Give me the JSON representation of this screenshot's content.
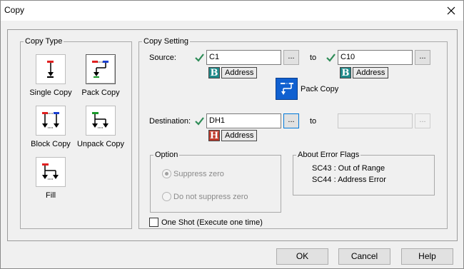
{
  "window": {
    "title": "Copy"
  },
  "copy_type": {
    "legend": "Copy Type",
    "items": [
      {
        "label": "Single Copy",
        "icon": "single-copy-icon"
      },
      {
        "label": "Pack Copy",
        "icon": "pack-copy-icon",
        "selected": true
      },
      {
        "label": "Block Copy",
        "icon": "block-copy-icon"
      },
      {
        "label": "Unpack Copy",
        "icon": "unpack-copy-icon"
      },
      {
        "label": "Fill",
        "icon": "fill-icon"
      }
    ]
  },
  "copy_setting": {
    "legend": "Copy Setting",
    "source": {
      "label": "Source:",
      "from_value": "C1",
      "to_label": "to",
      "to_value": "C10",
      "from_addr_badge": "B",
      "from_addr_label": "Address",
      "to_addr_badge": "B",
      "to_addr_label": "Address"
    },
    "pack_copy_label": "Pack Copy",
    "destination": {
      "label": "Destination:",
      "from_value": "DH1",
      "to_label": "to",
      "to_value": "",
      "addr_badge": "H",
      "addr_label": "Address"
    },
    "dots": "...",
    "option": {
      "legend": "Option",
      "suppress_zero": "Suppress zero",
      "no_suppress_zero": "Do not suppress zero",
      "selected": "suppress_zero"
    },
    "error_flags": {
      "legend": "About Error Flags",
      "lines": [
        "SC43 : Out of Range",
        "SC44 : Address Error"
      ]
    },
    "one_shot": "One Shot (Execute one time)"
  },
  "buttons": {
    "ok": "OK",
    "cancel": "Cancel",
    "help": "Help"
  },
  "colors": {
    "accent": "#0078d7",
    "check": "#2e8b57",
    "pack_button": "#1060d0"
  }
}
